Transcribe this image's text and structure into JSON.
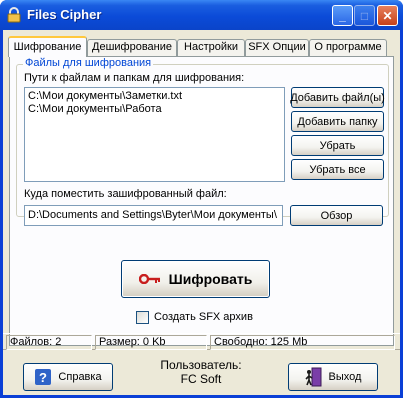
{
  "window": {
    "title": "Files Cipher"
  },
  "titlebar_buttons": {
    "minimize": "_",
    "maximize": "□",
    "close": "✕"
  },
  "tabs": [
    {
      "label": "Шифрование",
      "active": true
    },
    {
      "label": "Дешифрование",
      "active": false
    },
    {
      "label": "Настройки",
      "active": false
    },
    {
      "label": "SFX Опции",
      "active": false
    },
    {
      "label": "О программе",
      "active": false
    }
  ],
  "encrypt": {
    "group_title": "Файлы для шифрования",
    "paths_label": "Пути к файлам и папкам для шифрования:",
    "paths": [
      "C:\\Мои документы\\Заметки.txt",
      "C:\\Мои документы\\Работа"
    ],
    "add_files_button": "Добавить файл(ы)",
    "add_folder_button": "Добавить папку",
    "remove_button": "Убрать",
    "remove_all_button": "Убрать все",
    "destination_label": "Куда поместить зашифрованный файл:",
    "destination_value": "D:\\Documents and Settings\\Byter\\Мои документы\\",
    "browse_button": "Обзор",
    "encrypt_button": "Шифровать",
    "sfx_checkbox_label": "Создать SFX архив",
    "sfx_checked": false
  },
  "status": {
    "files": "Файлов: 2",
    "size": "Размер: 0 Kb",
    "free": "Свободно: 125 Mb"
  },
  "footer": {
    "help_button": "Справка",
    "user_label": "Пользователь:",
    "user_name": "FC Soft",
    "exit_button": "Выход"
  },
  "icons": {
    "app": "padlock-icon",
    "encrypt": "key-icon",
    "help": "question-icon",
    "exit": "exit-door-icon"
  },
  "colors": {
    "titlebar": "#0a4bd8",
    "client_bg": "#ece9d8",
    "group_title": "#0046d5",
    "active_tab_accent": "#ffc83c",
    "key_red": "#c81e1e"
  }
}
